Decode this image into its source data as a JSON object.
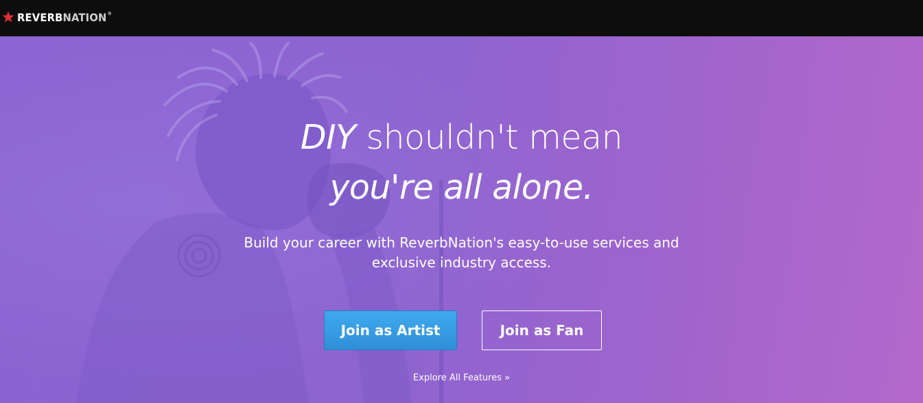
{
  "header": {
    "logo_bold": "REVERB",
    "logo_light": "NATION",
    "logo_reg": "®",
    "logo_icon": "star-icon",
    "background": "#0d0d0d",
    "star_color": "#e8312f"
  },
  "hero": {
    "headline_line1_italic": "DIY",
    "headline_line1_rest": " shouldn't mean",
    "headline_line2": "you're all alone.",
    "subtext_line1": "Build your career with ReverbNation's easy-to-use services and",
    "subtext_line2": "exclusive industry access.",
    "artist_button": "Join as Artist",
    "fan_button": "Join as Fan",
    "explore_link": "Explore All Features »",
    "colors": {
      "overlay": "#8d64d0",
      "artist_button": "#3a9fe6"
    }
  }
}
